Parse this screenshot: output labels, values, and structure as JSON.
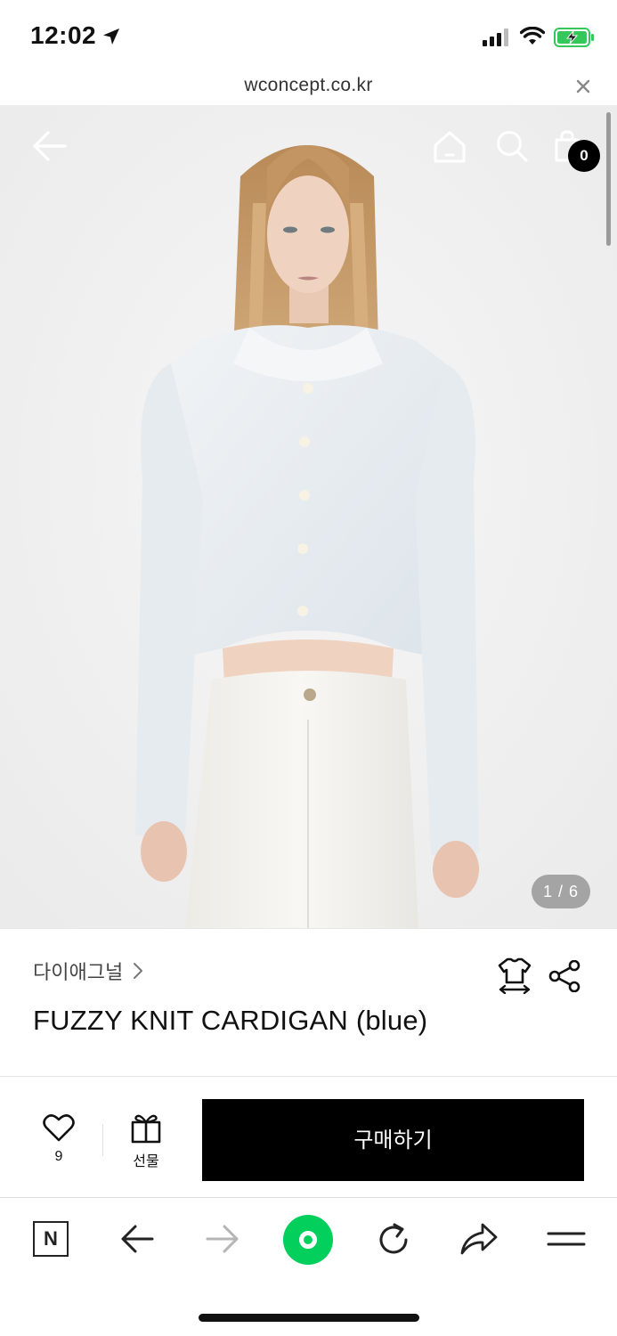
{
  "status_bar": {
    "time": "12:02"
  },
  "url_bar": {
    "url": "wconcept.co.kr"
  },
  "header": {
    "cart_count": "0"
  },
  "gallery": {
    "counter": "1 / 6"
  },
  "product": {
    "brand": "다이애그널",
    "title": "FUZZY KNIT CARDIGAN (blue)"
  },
  "actions": {
    "like_count": "9",
    "gift_label": "선물",
    "buy_label": "구매하기"
  },
  "browser_toolbar": {
    "n_label": "N"
  },
  "colors": {
    "accent_green": "#03cf5d",
    "buy_button": "#000000",
    "battery_green": "#34c759"
  }
}
